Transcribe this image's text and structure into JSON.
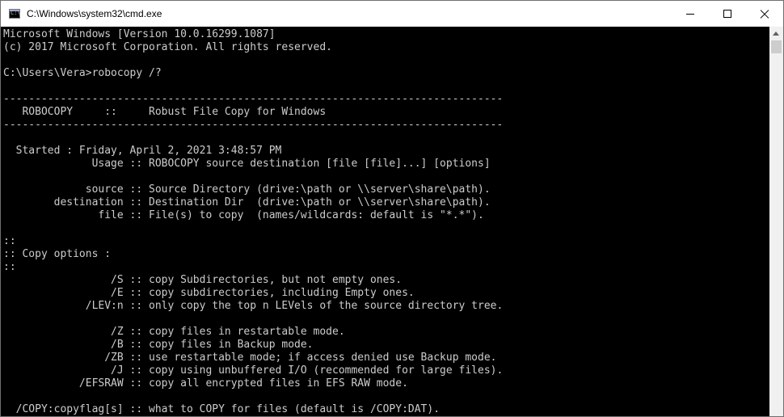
{
  "window": {
    "title": "C:\\Windows\\system32\\cmd.exe",
    "icon": "cmd-icon",
    "icon_glyph": "C:\\",
    "controls": {
      "minimize": "minimize-icon",
      "maximize": "maximize-icon",
      "close": "close-icon"
    }
  },
  "console": {
    "lines": [
      "Microsoft Windows [Version 10.0.16299.1087]",
      "(c) 2017 Microsoft Corporation. All rights reserved.",
      "",
      "C:\\Users\\Vera>robocopy /?",
      "",
      "-------------------------------------------------------------------------------",
      "   ROBOCOPY     ::     Robust File Copy for Windows",
      "-------------------------------------------------------------------------------",
      "",
      "  Started : Friday, April 2, 2021 3:48:57 PM",
      "              Usage :: ROBOCOPY source destination [file [file]...] [options]",
      "",
      "             source :: Source Directory (drive:\\path or \\\\server\\share\\path).",
      "        destination :: Destination Dir  (drive:\\path or \\\\server\\share\\path).",
      "               file :: File(s) to copy  (names/wildcards: default is \"*.*\").",
      "",
      "::",
      ":: Copy options :",
      "::",
      "                 /S :: copy Subdirectories, but not empty ones.",
      "                 /E :: copy subdirectories, including Empty ones.",
      "             /LEV:n :: only copy the top n LEVels of the source directory tree.",
      "",
      "                 /Z :: copy files in restartable mode.",
      "                 /B :: copy files in Backup mode.",
      "                /ZB :: use restartable mode; if access denied use Backup mode.",
      "                 /J :: copy using unbuffered I/O (recommended for large files).",
      "            /EFSRAW :: copy all encrypted files in EFS RAW mode.",
      "",
      "  /COPY:copyflag[s] :: what to COPY for files (default is /COPY:DAT)."
    ],
    "colors": {
      "background": "#000000",
      "foreground": "#cccccc"
    }
  },
  "scrollbar": {
    "up_arrow": "scroll-up-arrow-icon"
  }
}
